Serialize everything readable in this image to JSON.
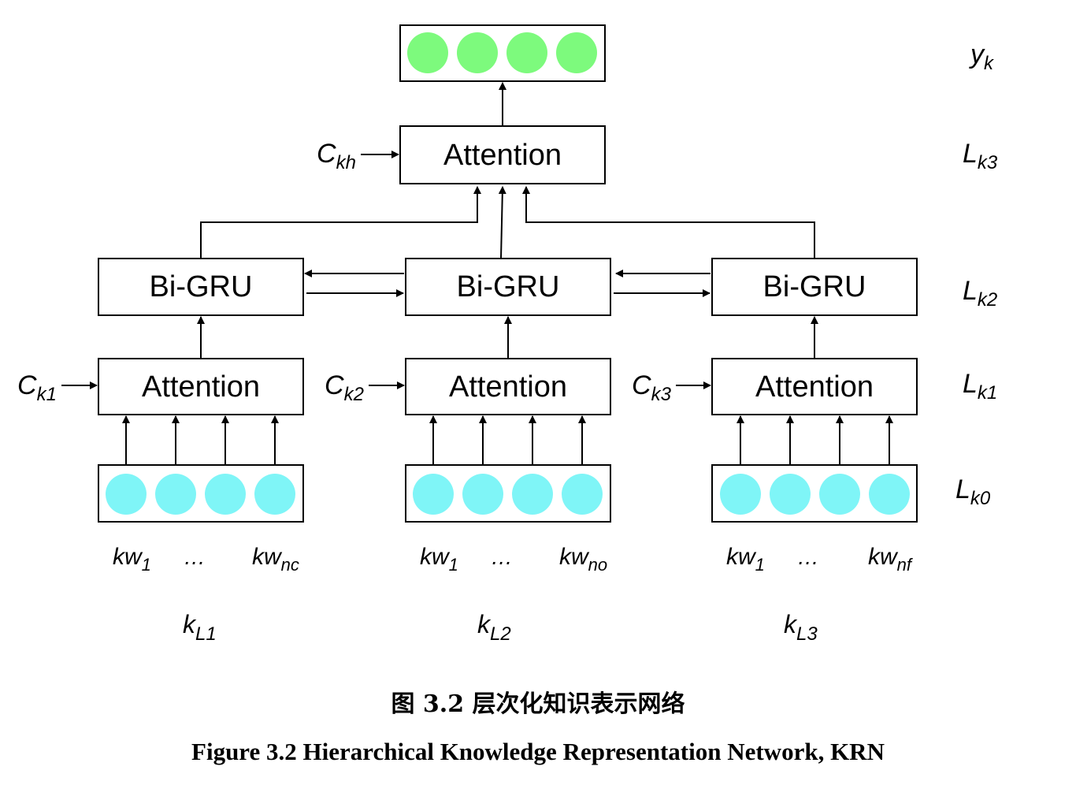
{
  "output": {
    "label": "y",
    "sub": "k",
    "node_color": "#7dfa7d",
    "node_count": 4
  },
  "top_attention": {
    "label": "Attention",
    "context": {
      "main": "C",
      "sub": "kh"
    }
  },
  "layers": [
    {
      "main": "L",
      "sub": "k3"
    },
    {
      "main": "L",
      "sub": "k2"
    },
    {
      "main": "L",
      "sub": "k1"
    },
    {
      "main": "L",
      "sub": "k0"
    }
  ],
  "columns": [
    {
      "bigru": "Bi-GRU",
      "attention": "Attention",
      "context": {
        "main": "C",
        "sub": "k1"
      },
      "words": [
        {
          "main": "kw",
          "sub": "1"
        },
        {
          "ellipsis": "…"
        },
        {
          "main": "kw",
          "sub": "nc"
        }
      ],
      "group": {
        "main": "k",
        "sub": "L1"
      }
    },
    {
      "bigru": "Bi-GRU",
      "attention": "Attention",
      "context": {
        "main": "C",
        "sub": "k2"
      },
      "words": [
        {
          "main": "kw",
          "sub": "1"
        },
        {
          "ellipsis": "…"
        },
        {
          "main": "kw",
          "sub": "no"
        }
      ],
      "group": {
        "main": "k",
        "sub": "L2"
      }
    },
    {
      "bigru": "Bi-GRU",
      "attention": "Attention",
      "context": {
        "main": "C",
        "sub": "k3"
      },
      "words": [
        {
          "main": "kw",
          "sub": "1"
        },
        {
          "ellipsis": "…"
        },
        {
          "main": "kw",
          "sub": "nf"
        }
      ],
      "group": {
        "main": "k",
        "sub": "L3"
      }
    }
  ],
  "input_node_color": "#7ff5f7",
  "caption": {
    "chinese": "图 3.2 层次化知识表示网络",
    "english": "Figure 3.2 Hierarchical Knowledge Representation Network, KRN"
  }
}
